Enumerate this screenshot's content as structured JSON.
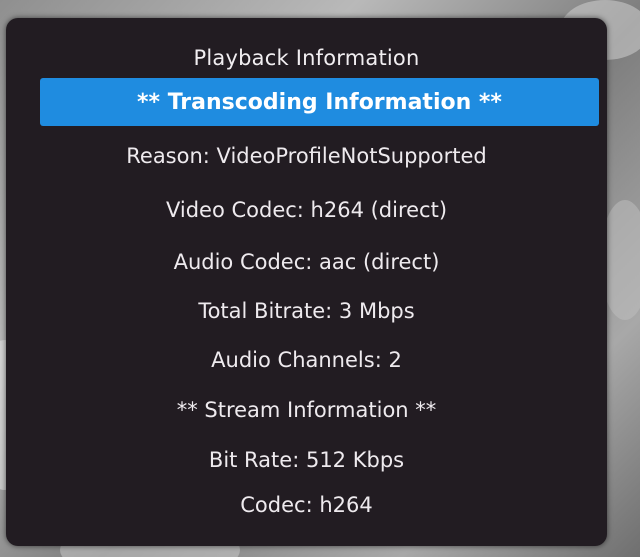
{
  "dialog": {
    "title": "Playback Information",
    "selected_item": "** Transcoding Information **",
    "lines": [
      "Reason: VideoProfileNotSupported",
      "Video Codec: h264 (direct)",
      "Audio Codec: aac (direct)",
      "Total Bitrate:  3 Mbps",
      "Audio Channels:  2",
      "** Stream Information **",
      "Bit Rate:  512 Kbps",
      "Codec: h264"
    ]
  },
  "colors": {
    "panel": "#221c22",
    "highlight": "#1f8ce0",
    "text": "#eeeaee"
  }
}
